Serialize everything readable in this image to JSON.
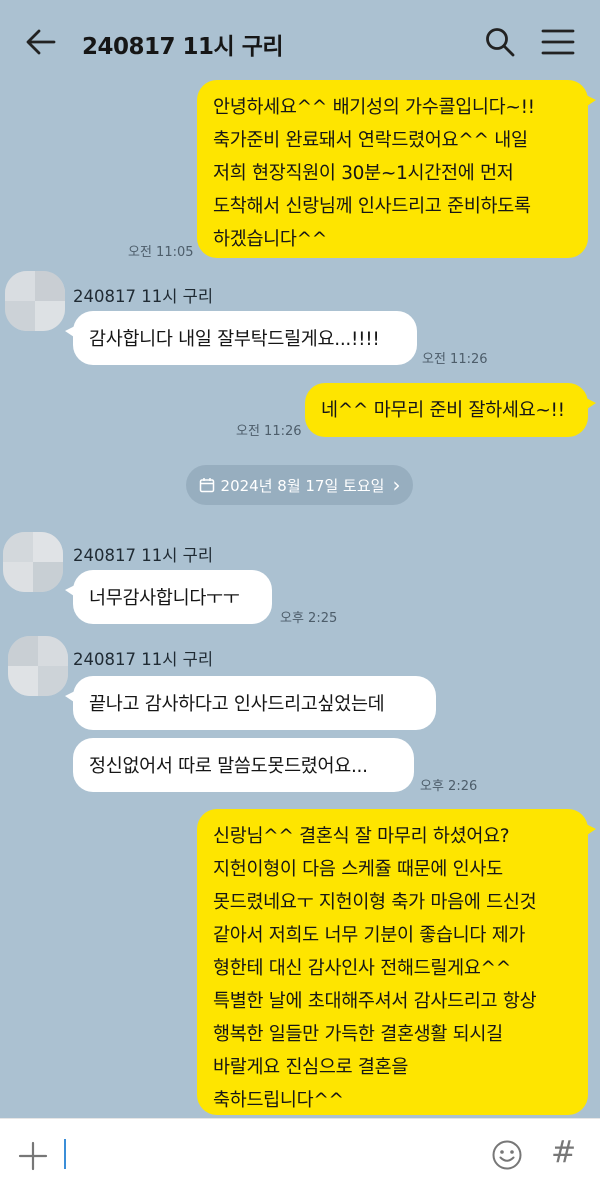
{
  "header": {
    "title": "240817 11시 구리",
    "back_icon": "arrow-left-icon",
    "search_icon": "search-icon",
    "menu_icon": "hamburger-menu-icon"
  },
  "messages": [
    {
      "from": "me",
      "text": "안녕하세요^^ 배기성의 가수콜입니다~!!\n축가준비 완료돼서 연락드렸어요^^ 내일\n저희 현장직원이 30분~1시간전에 먼저\n도착해서 신랑님께 인사드리고 준비하도록\n하겠습니다^^",
      "time": "오전 11:05"
    },
    {
      "from": "other",
      "sender": "240817 11시 구리",
      "text": "감사합니다 내일 잘부탁드릴게요...!!!!",
      "time": "오전 11:26"
    },
    {
      "from": "me",
      "text": "네^^ 마무리 준비 잘하세요~!!",
      "time": "오전 11:26"
    },
    {
      "from": "other",
      "sender": "240817 11시 구리",
      "text": "너무감사합니다ㅜㅜ",
      "time": "오후 2:25"
    },
    {
      "from": "other",
      "sender": "240817 11시 구리",
      "text": "끝나고 감사하다고 인사드리고싶었는데"
    },
    {
      "from": "other",
      "text": "정신없어서 따로 말씀도못드렸어요...",
      "time": "오후 2:26"
    },
    {
      "from": "me",
      "text": "신랑님^^ 결혼식 잘 마무리 하셨어요?\n지헌이형이 다음 스케쥴 때문에 인사도\n못드렸네요ㅜ 지헌이형 축가 마음에 드신것\n같아서 저희도 너무 기분이 좋습니다 제가\n형한테 대신 감사인사 전해드릴게요^^\n특별한 날에 초대해주셔서 감사드리고 항상\n행복한 일들만 가득한 결혼생활 되시길\n바랄게요 진심으로 결혼을\n축하드립니다^^"
    }
  ],
  "date_divider": {
    "text": "2024년 8월 17일 토요일",
    "icon": "calendar-icon",
    "chevron": "›"
  },
  "input_bar": {
    "plus_icon": "plus-icon",
    "emoji_icon": "emoji-icon",
    "hash_label": "#"
  },
  "colors": {
    "background": "#abc1d1",
    "my_bubble": "#fee500",
    "their_bubble": "#ffffff"
  }
}
